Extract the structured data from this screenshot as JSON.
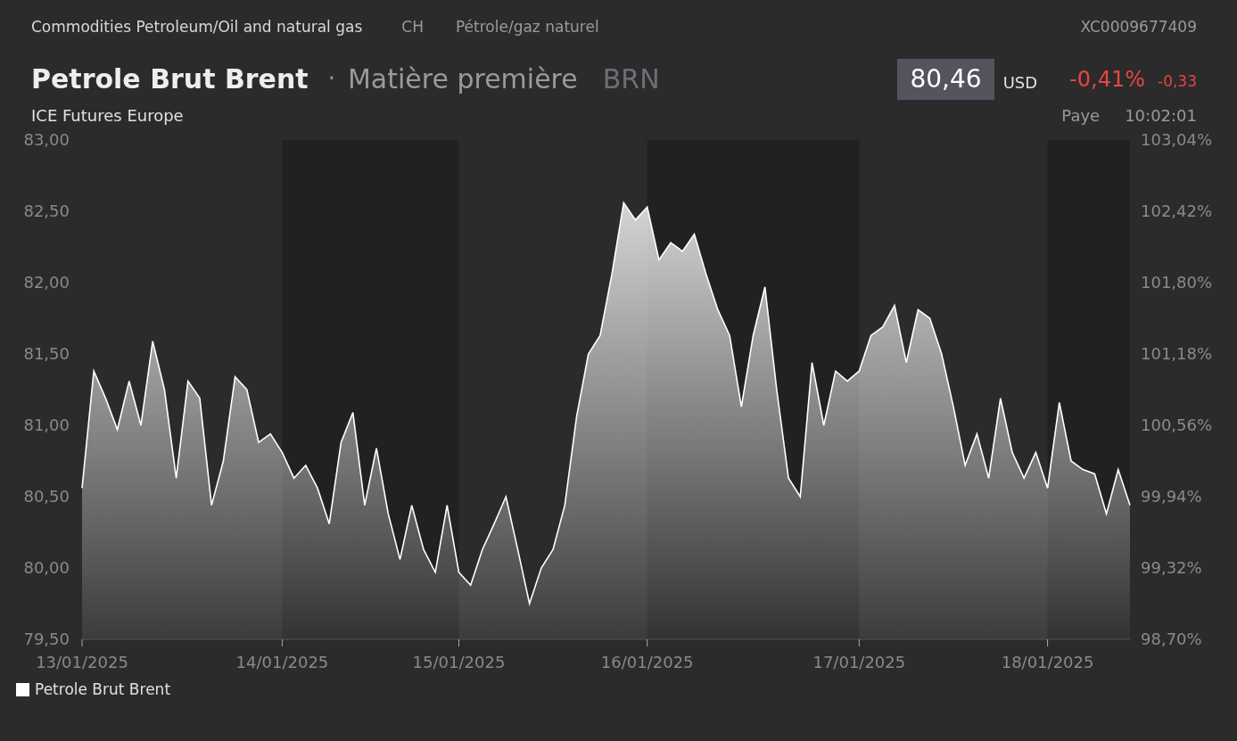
{
  "header": {
    "category": "Commodities Petroleum/Oil and natural gas",
    "country": "CH",
    "sector": "Pétrole/gaz naturel",
    "isin": "XC0009677409"
  },
  "title": {
    "name": "Petrole Brut Brent",
    "separator": "·",
    "type": "Matière première",
    "symbol": "BRN"
  },
  "quote": {
    "price": "80,46",
    "currency": "USD",
    "change_percent": "-0,41%",
    "change": "-0,33"
  },
  "subheader": {
    "exchange": "ICE Futures Europe",
    "status": "Paye",
    "time": "10:02:01"
  },
  "chart": {
    "right_axis_labels": [
      "103,04%",
      "102,42%",
      "101,80%",
      "101,18%",
      "100,56%",
      "99,94%",
      "99,32%",
      "98,70%"
    ],
    "chart_data": {
      "type": "area",
      "categories": [
        "13/01/2025",
        null,
        null,
        null,
        null,
        null,
        null,
        null,
        null,
        null,
        null,
        null,
        null,
        null,
        null,
        null,
        null,
        "14/01/2025",
        null,
        null,
        null,
        null,
        null,
        null,
        null,
        null,
        null,
        null,
        null,
        null,
        null,
        null,
        "15/01/2025",
        null,
        null,
        null,
        null,
        null,
        null,
        null,
        null,
        null,
        null,
        null,
        null,
        null,
        null,
        null,
        "16/01/2025",
        null,
        null,
        null,
        null,
        null,
        null,
        null,
        null,
        null,
        null,
        null,
        null,
        null,
        null,
        null,
        null,
        null,
        "17/01/2025",
        null,
        null,
        null,
        null,
        null,
        null,
        null,
        null,
        null,
        null,
        null,
        null,
        null,
        null,
        null,
        "18/01/2025",
        null,
        null,
        null,
        null,
        null,
        null,
        null
      ],
      "series": [
        {
          "name": "Petrole Brut Brent",
          "color": "#ffffff",
          "values": [
            80.56,
            81.38,
            81.19,
            80.97,
            81.31,
            81.0,
            81.59,
            81.25,
            80.63,
            81.31,
            81.19,
            80.44,
            80.75,
            81.34,
            81.25,
            80.88,
            80.94,
            80.81,
            80.63,
            80.72,
            80.56,
            80.31,
            80.88,
            81.09,
            80.44,
            80.84,
            80.38,
            80.06,
            80.44,
            80.13,
            79.97,
            80.44,
            79.97,
            79.88,
            80.13,
            80.31,
            80.5,
            80.13,
            79.75,
            80.0,
            80.13,
            80.44,
            81.06,
            81.5,
            81.63,
            82.06,
            82.56,
            82.44,
            82.53,
            82.16,
            82.28,
            82.22,
            82.34,
            82.06,
            81.81,
            81.63,
            81.13,
            81.63,
            81.97,
            81.25,
            80.63,
            80.5,
            81.44,
            81.0,
            81.38,
            81.31,
            81.38,
            81.63,
            81.69,
            81.84,
            81.44,
            81.81,
            81.75,
            81.5,
            81.13,
            80.72,
            80.94,
            80.63,
            81.19,
            80.81,
            80.63,
            80.81,
            80.56,
            81.16,
            80.75,
            80.69,
            80.66,
            80.38,
            80.69,
            80.44
          ]
        }
      ],
      "ylim": [
        79.5,
        83.0
      ],
      "yticks": [
        {
          "value": 79.5,
          "label": "79,50"
        },
        {
          "value": 80,
          "label": "80,00"
        },
        {
          "value": 80.5,
          "label": "80,50"
        },
        {
          "value": 81,
          "label": "81,00"
        },
        {
          "value": 81.5,
          "label": "81,50"
        },
        {
          "value": 82,
          "label": "82,00"
        },
        {
          "value": 82.5,
          "label": "82,50"
        },
        {
          "value": 83,
          "label": "83,00"
        }
      ]
    }
  }
}
